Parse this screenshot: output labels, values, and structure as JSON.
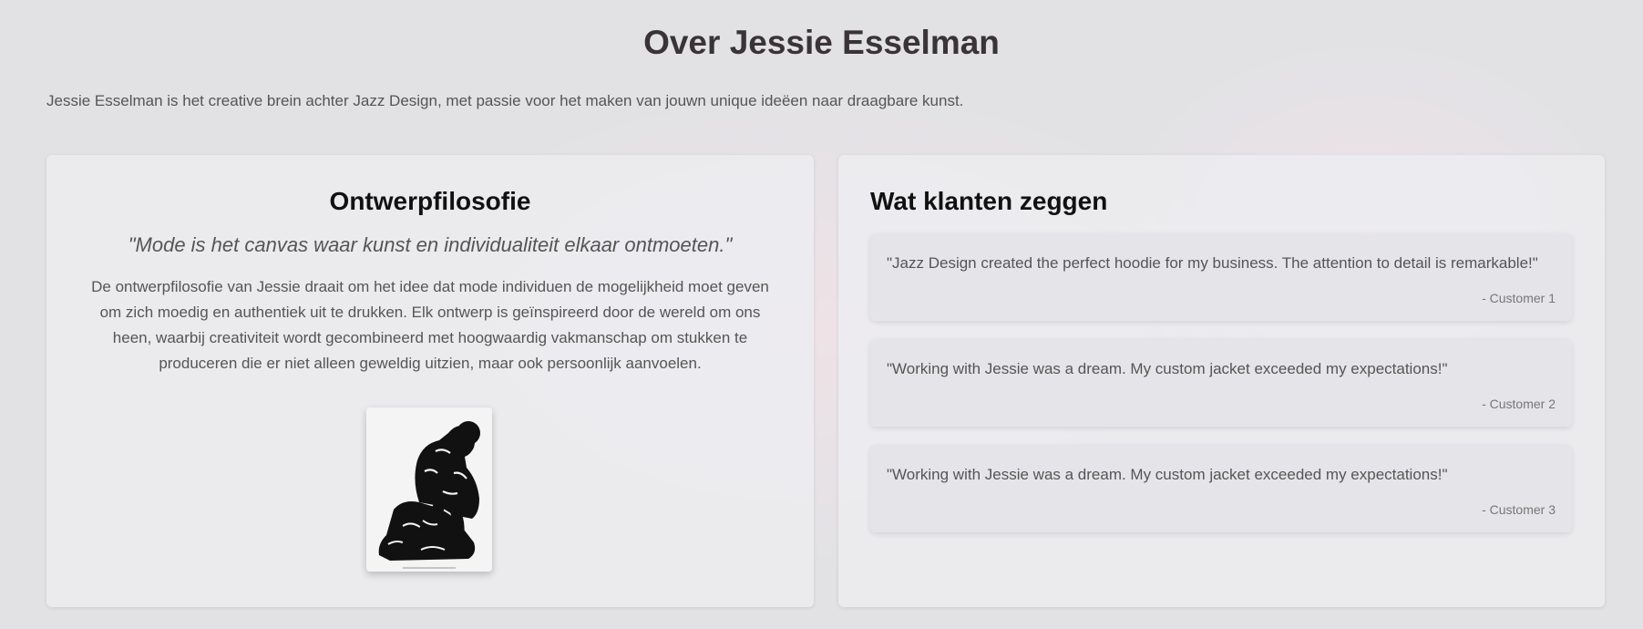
{
  "page": {
    "title": "Over Jessie Esselman",
    "intro": "Jessie Esselman is het creative brein achter Jazz Design, met passie voor het maken van jouwn unique ideëen naar draagbare kunst."
  },
  "philosophy": {
    "heading": "Ontwerpfilosofie",
    "quote": "\"Mode is het canvas waar kunst en individualiteit elkaar ontmoeten.\"",
    "text": "De ontwerpfilosofie van Jessie draait om het idee dat mode individuen de mogelijkheid moet geven om zich moedig en authentiek uit te drukken. Elk ontwerp is geïnspireerd door de wereld om ons heen, waarbij creativiteit wordt gecombineerd met hoogwaardig vakmanschap om stukken te produceren die er niet alleen geweldig uitzien, maar ook persoonlijk aanvoelen.",
    "image_icon": "thinker-statue-icon"
  },
  "testimonials": {
    "heading": "Wat klanten zeggen",
    "items": [
      {
        "text": "\"Jazz Design created the perfect hoodie for my business. The attention to detail is remarkable!\"",
        "author": "- Customer 1"
      },
      {
        "text": "\"Working with Jessie was a dream. My custom jacket exceeded my expectations!\"",
        "author": "- Customer 2"
      },
      {
        "text": "\"Working with Jessie was a dream. My custom jacket exceeded my expectations!\"",
        "author": "- Customer 3"
      }
    ]
  },
  "colors": {
    "background": "#e2e2e5",
    "card": "#ececf0",
    "heading": "#111111",
    "text": "#555555"
  }
}
